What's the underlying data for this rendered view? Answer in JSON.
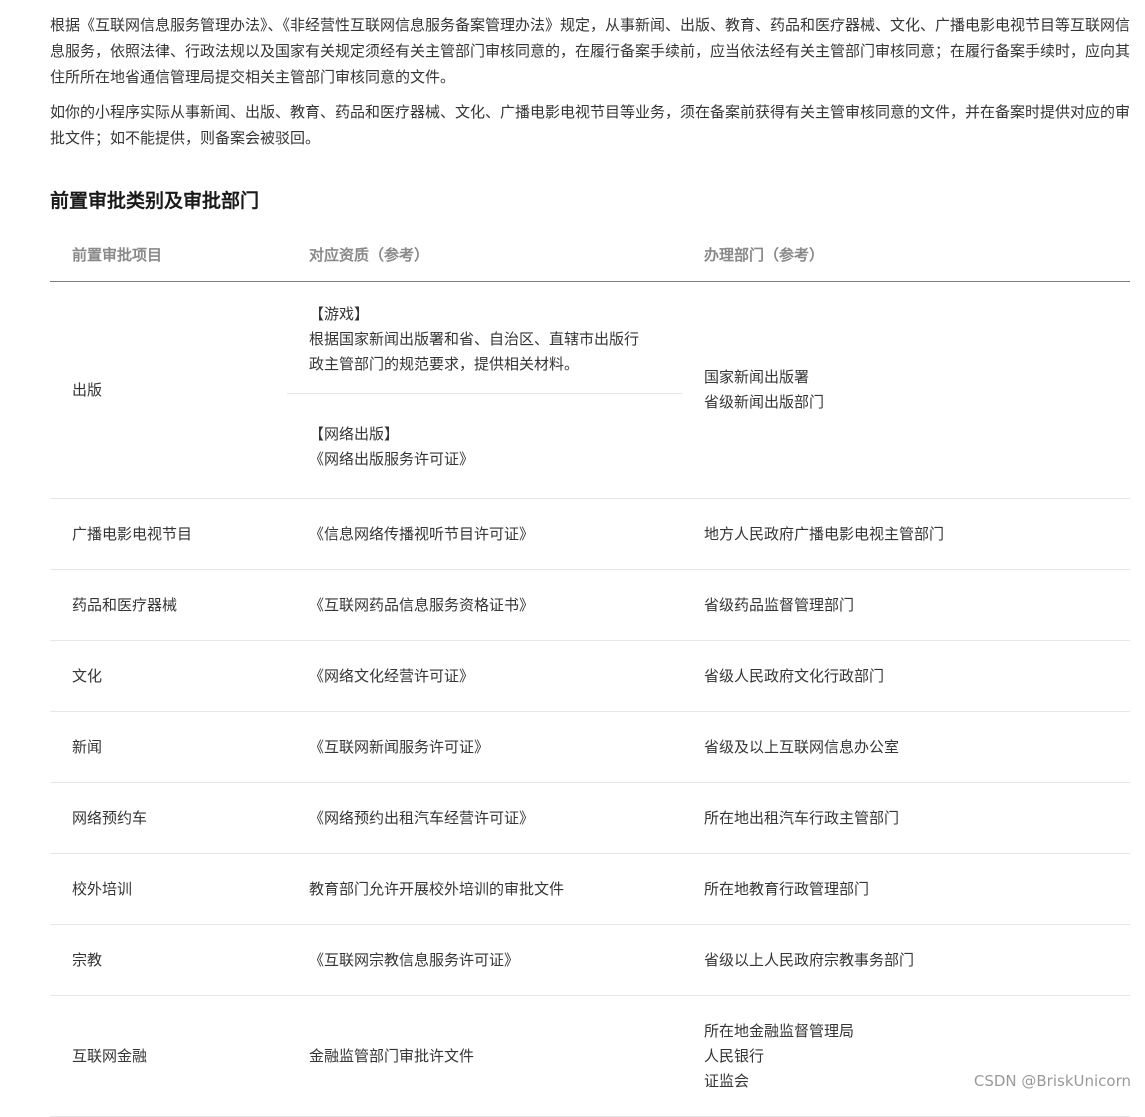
{
  "intro": {
    "paragraph1": "根据《互联网信息服务管理办法》、《非经营性互联网信息服务备案管理办法》规定，从事新闻、出版、教育、药品和医疗器械、文化、广播电影电视节目等互联网信息服务，依照法律、行政法规以及国家有关规定须经有关主管部门审核同意的，在履行备案手续前，应当依法经有关主管部门审核同意；在履行备案手续时，应向其住所所在地省通信管理局提交相关主管部门审核同意的文件。",
    "paragraph2": "如你的小程序实际从事新闻、出版、教育、药品和医疗器械、文化、广播电影电视节目等业务，须在备案前获得有关主管审核同意的文件，并在备案时提供对应的审批文件；如不能提供，则备案会被驳回。"
  },
  "section": {
    "title": "前置审批类别及审批部门"
  },
  "table": {
    "headers": [
      "前置审批项目",
      "对应资质（参考）",
      "办理部门（参考）"
    ],
    "publishing": {
      "item": "出版",
      "game_tag": "【游戏】",
      "game_desc_line1": "根据国家新闻出版署和省、自治区、直辖市出版行",
      "game_desc_line2": "政主管部门的规范要求，提供相关材料。",
      "net_tag": "【网络出版】",
      "net_desc": "《网络出版服务许可证》",
      "dept_line1": "国家新闻出版署",
      "dept_line2": "省级新闻出版部门"
    },
    "rows": [
      {
        "item": "广播电影电视节目",
        "qual": "《信息网络传播视听节目许可证》",
        "dept": "地方人民政府广播电影电视主管部门"
      },
      {
        "item": "药品和医疗器械",
        "qual": "《互联网药品信息服务资格证书》",
        "dept": "省级药品监督管理部门"
      },
      {
        "item": "文化",
        "qual": "《网络文化经营许可证》",
        "dept": "省级人民政府文化行政部门"
      },
      {
        "item": "新闻",
        "qual": "《互联网新闻服务许可证》",
        "dept": "省级及以上互联网信息办公室"
      },
      {
        "item": "网络预约车",
        "qual": "《网络预约出租汽车经营许可证》",
        "dept": "所在地出租汽车行政主管部门"
      },
      {
        "item": "校外培训",
        "qual": "教育部门允许开展校外培训的审批文件",
        "dept": "所在地教育行政管理部门"
      },
      {
        "item": "宗教",
        "qual": "《互联网宗教信息服务许可证》",
        "dept": "省级以上人民政府宗教事务部门"
      }
    ],
    "finance": {
      "item": "互联网金融",
      "qual": "金融监管部门审批许文件",
      "dept_line1": "所在地金融监督管理局",
      "dept_line2": "人民银行",
      "dept_line3": "证监会"
    }
  },
  "watermark": "CSDN @BriskUnicorn"
}
